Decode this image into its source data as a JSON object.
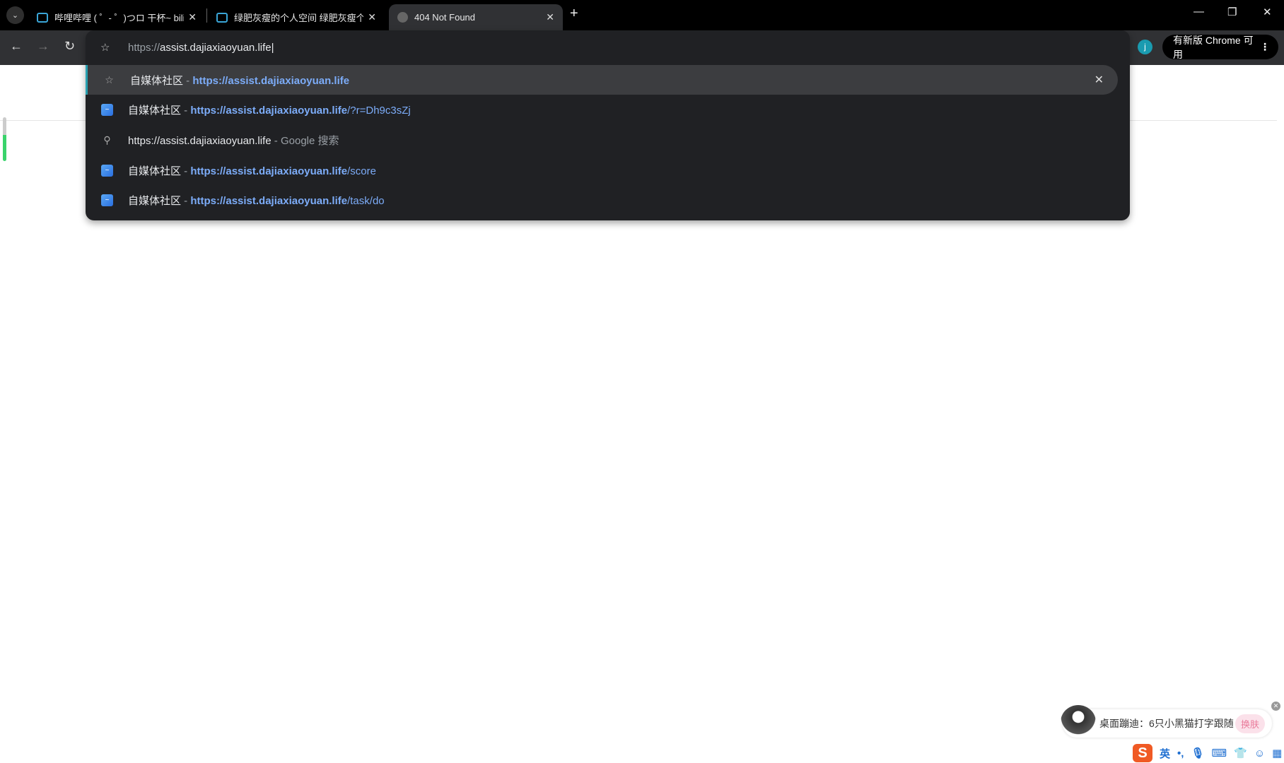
{
  "tabs": [
    {
      "title": "哔哩哔哩 ( ゜- ゜)つロ 干杯~ bili",
      "active": false
    },
    {
      "title": "绿肥灰瘦的个人空间 绿肥灰瘦个",
      "active": false
    },
    {
      "title": "404 Not Found",
      "active": true
    }
  ],
  "toolbar": {
    "address_scheme": "https://",
    "address_host": "assist.dajiaxiaoyuan.life",
    "avatar_letter": "j",
    "update_label": "有新版 Chrome 可用"
  },
  "suggestions": [
    {
      "icon": "star-icon",
      "title": "自媒体社区",
      "url": "https://assist.dajiaxiaoyuan.life",
      "path": ""
    },
    {
      "icon": "site-favicon-icon",
      "title": "自媒体社区",
      "url": "https://assist.dajiaxiaoyuan.life",
      "path": "/?r=Dh9c3sZj"
    },
    {
      "icon": "search-icon",
      "query": "https://assist.dajiaxiaoyuan.life",
      "hint": "Google 搜索"
    },
    {
      "icon": "site-favicon-icon",
      "title": "自媒体社区",
      "url": "https://assist.dajiaxiaoyuan.life",
      "path": "/score"
    },
    {
      "icon": "site-favicon-icon",
      "title": "自媒体社区",
      "url": "https://assist.dajiaxiaoyuan.life",
      "path": "/task/do"
    }
  ],
  "ime": {
    "tip": "桌面蹦迪：6只小黑猫打字跟随",
    "skin_button": "换肤",
    "lang": "英",
    "punct": "•,"
  }
}
